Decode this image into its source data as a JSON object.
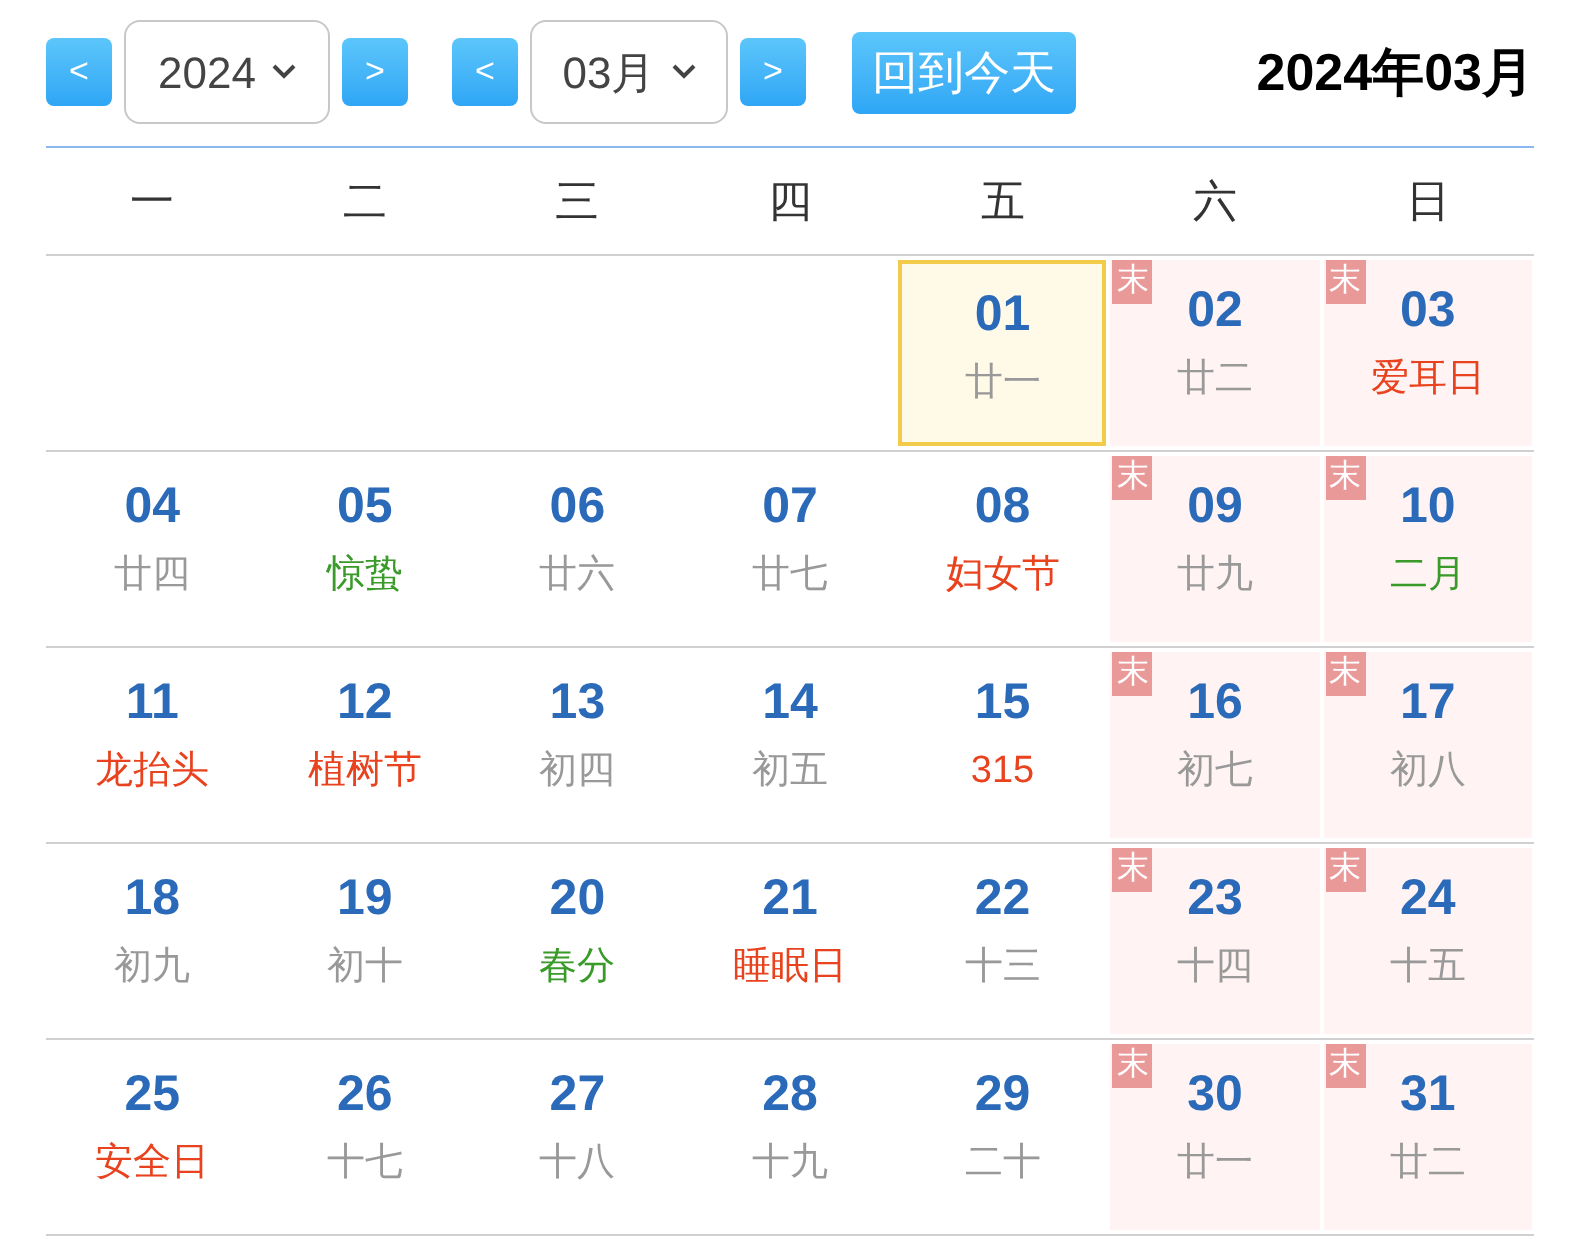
{
  "toolbar": {
    "prev": "<",
    "next": ">",
    "year": "2024",
    "month": "03月",
    "today_button": "回到今天",
    "title": "2024年03月"
  },
  "weekdays": [
    "一",
    "二",
    "三",
    "四",
    "五",
    "六",
    "日"
  ],
  "weeks": [
    [
      {
        "kind": "blank"
      },
      {
        "kind": "blank"
      },
      {
        "kind": "blank"
      },
      {
        "kind": "blank"
      },
      {
        "kind": "lunar",
        "day": "01",
        "sub": "廿一",
        "today": true
      },
      {
        "kind": "lunar",
        "day": "02",
        "sub": "廿二",
        "badge": "末",
        "today": false
      },
      {
        "kind": "festival",
        "day": "03",
        "sub": "爱耳日",
        "badge": "末",
        "today": false
      }
    ],
    [
      {
        "kind": "lunar",
        "day": "04",
        "sub": "廿四",
        "today": false
      },
      {
        "kind": "term",
        "day": "05",
        "sub": "惊蛰",
        "today": false
      },
      {
        "kind": "lunar",
        "day": "06",
        "sub": "廿六",
        "today": false
      },
      {
        "kind": "lunar",
        "day": "07",
        "sub": "廿七",
        "today": false
      },
      {
        "kind": "festival",
        "day": "08",
        "sub": "妇女节",
        "today": false
      },
      {
        "kind": "lunar",
        "day": "09",
        "sub": "廿九",
        "badge": "末",
        "today": false
      },
      {
        "kind": "term",
        "day": "10",
        "sub": "二月",
        "badge": "末",
        "today": false
      }
    ],
    [
      {
        "kind": "festival",
        "day": "11",
        "sub": "龙抬头",
        "today": false
      },
      {
        "kind": "festival",
        "day": "12",
        "sub": "植树节",
        "today": false
      },
      {
        "kind": "lunar",
        "day": "13",
        "sub": "初四",
        "today": false
      },
      {
        "kind": "lunar",
        "day": "14",
        "sub": "初五",
        "today": false
      },
      {
        "kind": "festival",
        "day": "15",
        "sub": "315",
        "today": false
      },
      {
        "kind": "lunar",
        "day": "16",
        "sub": "初七",
        "badge": "末",
        "today": false
      },
      {
        "kind": "lunar",
        "day": "17",
        "sub": "初八",
        "badge": "末",
        "today": false
      }
    ],
    [
      {
        "kind": "lunar",
        "day": "18",
        "sub": "初九",
        "today": false
      },
      {
        "kind": "lunar",
        "day": "19",
        "sub": "初十",
        "today": false
      },
      {
        "kind": "term",
        "day": "20",
        "sub": "春分",
        "today": false
      },
      {
        "kind": "festival",
        "day": "21",
        "sub": "睡眠日",
        "today": false
      },
      {
        "kind": "lunar",
        "day": "22",
        "sub": "十三",
        "today": false
      },
      {
        "kind": "lunar",
        "day": "23",
        "sub": "十四",
        "badge": "末",
        "today": false
      },
      {
        "kind": "lunar",
        "day": "24",
        "sub": "十五",
        "badge": "末",
        "today": false
      }
    ],
    [
      {
        "kind": "festival",
        "day": "25",
        "sub": "安全日",
        "today": false
      },
      {
        "kind": "lunar",
        "day": "26",
        "sub": "十七",
        "today": false
      },
      {
        "kind": "lunar",
        "day": "27",
        "sub": "十八",
        "today": false
      },
      {
        "kind": "lunar",
        "day": "28",
        "sub": "十九",
        "today": false
      },
      {
        "kind": "lunar",
        "day": "29",
        "sub": "二十",
        "today": false
      },
      {
        "kind": "lunar",
        "day": "30",
        "sub": "廿一",
        "badge": "末",
        "today": false
      },
      {
        "kind": "lunar",
        "day": "31",
        "sub": "廿二",
        "badge": "末",
        "today": false
      }
    ]
  ]
}
